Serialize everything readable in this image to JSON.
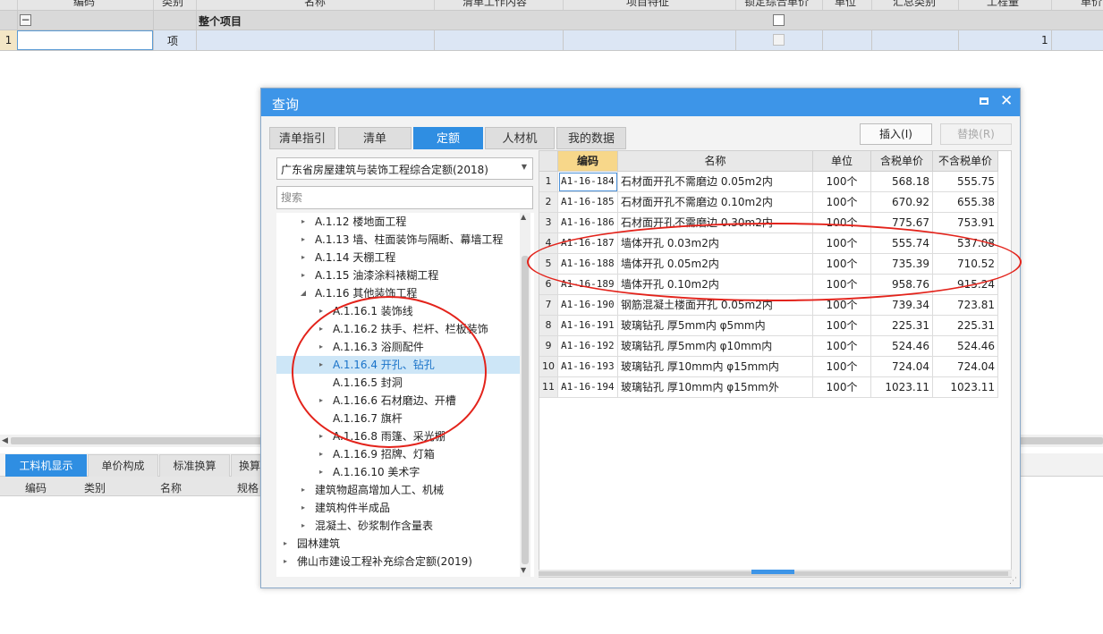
{
  "main_grid": {
    "headers": [
      "编码",
      "类别",
      "名称",
      "清单工作内容",
      "项目特征",
      "锁定综合单价",
      "单位",
      "汇总类别",
      "工程量",
      "单价"
    ],
    "group_row": {
      "label": "整个项目",
      "collapse": "−"
    },
    "item_row": {
      "row_no": "1",
      "type": "项",
      "quantity": "1"
    }
  },
  "bottom_panel": {
    "tabs": [
      "工料机显示",
      "单价构成",
      "标准换算",
      "换算"
    ],
    "columns": [
      "编码",
      "类别",
      "名称",
      "规格"
    ]
  },
  "dialog": {
    "title": "查询",
    "tabs": [
      "清单指引",
      "清单",
      "定额",
      "人材机",
      "我的数据"
    ],
    "active_tab": "定额",
    "insert_button": "插入(I)",
    "replace_button": "替换(R)",
    "library": "广东省房屋建筑与装饰工程综合定额(2018)",
    "search_placeholder": "搜索",
    "tree": [
      {
        "label": "A.1.12 楼地面工程",
        "expand": "▸"
      },
      {
        "label": "A.1.13 墙、柱面装饰与隔断、幕墙工程",
        "expand": "▸"
      },
      {
        "label": "A.1.14 天棚工程",
        "expand": "▸"
      },
      {
        "label": "A.1.15 油漆涂料裱糊工程",
        "expand": "▸"
      },
      {
        "label": "A.1.16 其他装饰工程",
        "expand": "◢"
      },
      {
        "label": "A.1.16.1 装饰线",
        "expand": "▸"
      },
      {
        "label": "A.1.16.2 扶手、栏杆、栏板装饰",
        "expand": "▸"
      },
      {
        "label": "A.1.16.3 浴厕配件",
        "expand": "▸"
      },
      {
        "label": "A.1.16.4 开孔、钻孔",
        "expand": "▸"
      },
      {
        "label": "A.1.16.5 封洞",
        "expand": ""
      },
      {
        "label": "A.1.16.6 石材磨边、开槽",
        "expand": "▸"
      },
      {
        "label": "A.1.16.7 旗杆",
        "expand": ""
      },
      {
        "label": "A.1.16.8 雨篷、采光棚",
        "expand": "▸"
      },
      {
        "label": "A.1.16.9 招牌、灯箱",
        "expand": "▸"
      },
      {
        "label": "A.1.16.10 美术字",
        "expand": "▸"
      },
      {
        "label": "建筑物超高增加人工、机械",
        "expand": "▸"
      },
      {
        "label": "建筑构件半成品",
        "expand": "▸"
      },
      {
        "label": "混凝土、砂浆制作含量表",
        "expand": "▸"
      },
      {
        "label": "园林建筑",
        "expand": "▸"
      },
      {
        "label": "佛山市建设工程补充综合定额(2019)",
        "expand": "▸"
      }
    ],
    "selected_tree_label": "A.1.16.4 开孔、钻孔",
    "grid": {
      "headers": [
        "编码",
        "名称",
        "单位",
        "含税单价",
        "不含税单价"
      ],
      "rows": [
        {
          "no": "1",
          "code": "A1-16-184",
          "name": "石材面开孔不需磨边 0.05m2内",
          "unit": "100个",
          "price_tax": "568.18",
          "price_notax": "555.75"
        },
        {
          "no": "2",
          "code": "A1-16-185",
          "name": "石材面开孔不需磨边 0.10m2内",
          "unit": "100个",
          "price_tax": "670.92",
          "price_notax": "655.38"
        },
        {
          "no": "3",
          "code": "A1-16-186",
          "name": "石材面开孔不需磨边 0.30m2内",
          "unit": "100个",
          "price_tax": "775.67",
          "price_notax": "753.91"
        },
        {
          "no": "4",
          "code": "A1-16-187",
          "name": "墙体开孔 0.03m2内",
          "unit": "100个",
          "price_tax": "555.74",
          "price_notax": "537.08"
        },
        {
          "no": "5",
          "code": "A1-16-188",
          "name": "墙体开孔 0.05m2内",
          "unit": "100个",
          "price_tax": "735.39",
          "price_notax": "710.52"
        },
        {
          "no": "6",
          "code": "A1-16-189",
          "name": "墙体开孔 0.10m2内",
          "unit": "100个",
          "price_tax": "958.76",
          "price_notax": "915.24"
        },
        {
          "no": "7",
          "code": "A1-16-190",
          "name": "钢筋混凝土楼面开孔 0.05m2内",
          "unit": "100个",
          "price_tax": "739.34",
          "price_notax": "723.81"
        },
        {
          "no": "8",
          "code": "A1-16-191",
          "name": "玻璃钻孔 厚5mm内 φ5mm内",
          "unit": "100个",
          "price_tax": "225.31",
          "price_notax": "225.31"
        },
        {
          "no": "9",
          "code": "A1-16-192",
          "name": "玻璃钻孔 厚5mm内 φ10mm内",
          "unit": "100个",
          "price_tax": "524.46",
          "price_notax": "524.46"
        },
        {
          "no": "10",
          "code": "A1-16-193",
          "name": "玻璃钻孔 厚10mm内 φ15mm内",
          "unit": "100个",
          "price_tax": "724.04",
          "price_notax": "724.04"
        },
        {
          "no": "11",
          "code": "A1-16-194",
          "name": "玻璃钻孔 厚10mm内 φ15mm外",
          "unit": "100个",
          "price_tax": "1023.11",
          "price_notax": "1023.11"
        }
      ]
    }
  },
  "colors": {
    "accent": "#2f8ee2",
    "title_bar": "#3d95e8",
    "annotation": "#e3231b",
    "selected_header": "#f7d78a"
  }
}
